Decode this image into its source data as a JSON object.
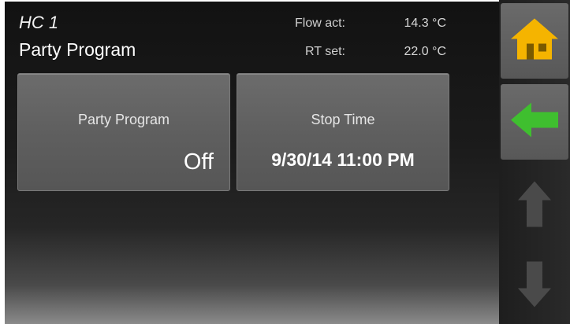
{
  "header": {
    "circuit": "HC 1",
    "title": "Party Program"
  },
  "sensors": [
    {
      "label": "Flow act:",
      "value": "14.3 °C"
    },
    {
      "label": "RT set:",
      "value": "22.0 °C"
    }
  ],
  "tiles": {
    "party": {
      "label": "Party Program",
      "value": "Off"
    },
    "stop": {
      "label": "Stop Time",
      "value": "9/30/14 11:00 PM"
    }
  },
  "sidebar": {
    "icons": [
      "home-icon",
      "back-arrow-icon",
      "up-arrow-icon",
      "down-arrow-icon"
    ],
    "colors": {
      "home": "#f5b400",
      "back": "#3fbf2f",
      "disabled": "#4a4a4a"
    }
  }
}
